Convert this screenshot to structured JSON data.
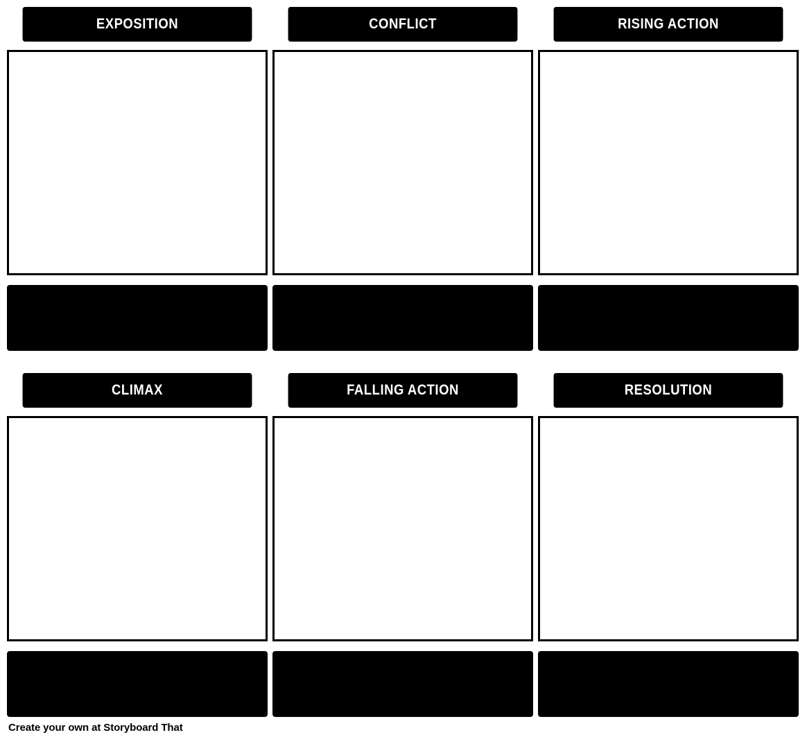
{
  "storyboard": {
    "rows": [
      {
        "cells": [
          {
            "title": "EXPOSITION",
            "description": ""
          },
          {
            "title": "CONFLICT",
            "description": ""
          },
          {
            "title": "RISING ACTION",
            "description": ""
          }
        ]
      },
      {
        "cells": [
          {
            "title": "CLIMAX",
            "description": ""
          },
          {
            "title": "FALLING ACTION",
            "description": ""
          },
          {
            "title": "RESOLUTION",
            "description": ""
          }
        ]
      }
    ]
  },
  "footer": {
    "text": "Create your own at Storyboard That"
  },
  "colors": {
    "background": "#ffffff",
    "panel_border": "#000000",
    "title_background": "#000000",
    "title_text": "#ffffff",
    "description_background": "#000000",
    "footer_text": "#000000"
  }
}
